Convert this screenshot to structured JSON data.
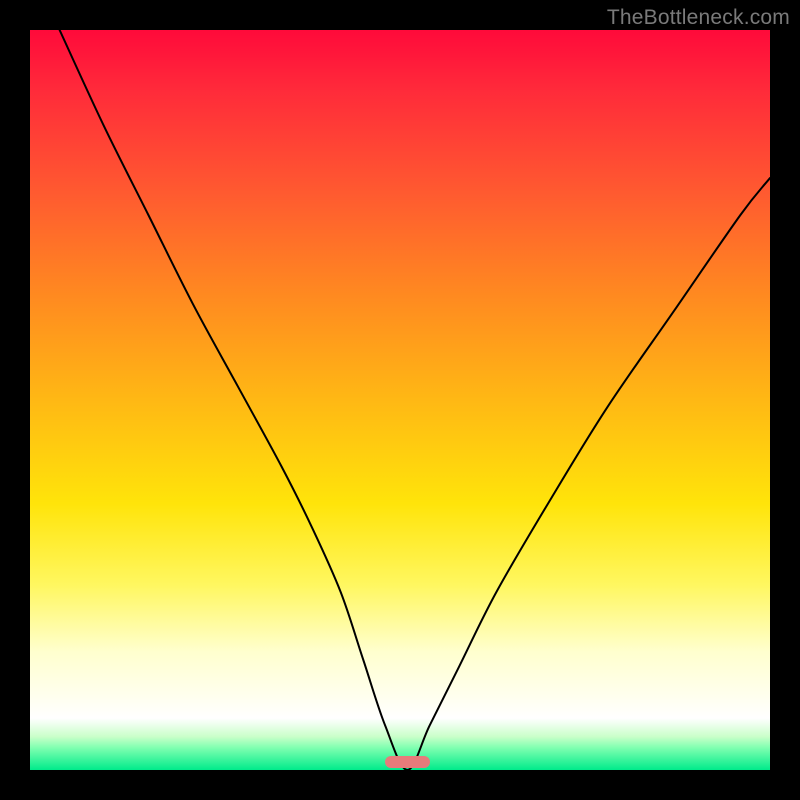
{
  "watermark": "TheBottleneck.com",
  "chart_data": {
    "type": "line",
    "title": "",
    "xlabel": "",
    "ylabel": "",
    "xlim": [
      0,
      100
    ],
    "ylim": [
      0,
      100
    ],
    "grid": false,
    "legend": false,
    "marker": {
      "x": 51,
      "width_pct": 6,
      "color": "#e77b7b"
    },
    "series": [
      {
        "name": "bottleneck-curve",
        "x": [
          4,
          10,
          16,
          22,
          28,
          34,
          38,
          42,
          45,
          48,
          51,
          54,
          58,
          63,
          70,
          78,
          87,
          96,
          100
        ],
        "y": [
          100,
          87,
          75,
          63,
          52,
          41,
          33,
          24,
          15,
          6,
          0,
          6,
          14,
          24,
          36,
          49,
          62,
          75,
          80
        ]
      }
    ],
    "background_gradient_stops": [
      {
        "pct": 0,
        "color": "#ff0a3a"
      },
      {
        "pct": 8,
        "color": "#ff2a3a"
      },
      {
        "pct": 22,
        "color": "#ff5a30"
      },
      {
        "pct": 36,
        "color": "#ff8a20"
      },
      {
        "pct": 50,
        "color": "#ffb814"
      },
      {
        "pct": 64,
        "color": "#ffe40a"
      },
      {
        "pct": 75,
        "color": "#fff760"
      },
      {
        "pct": 84,
        "color": "#ffffce"
      },
      {
        "pct": 90,
        "color": "#ffffee"
      },
      {
        "pct": 93,
        "color": "#ffffff"
      },
      {
        "pct": 95.5,
        "color": "#c9ffc9"
      },
      {
        "pct": 97,
        "color": "#7fffb0"
      },
      {
        "pct": 100,
        "color": "#00eb8b"
      }
    ]
  }
}
